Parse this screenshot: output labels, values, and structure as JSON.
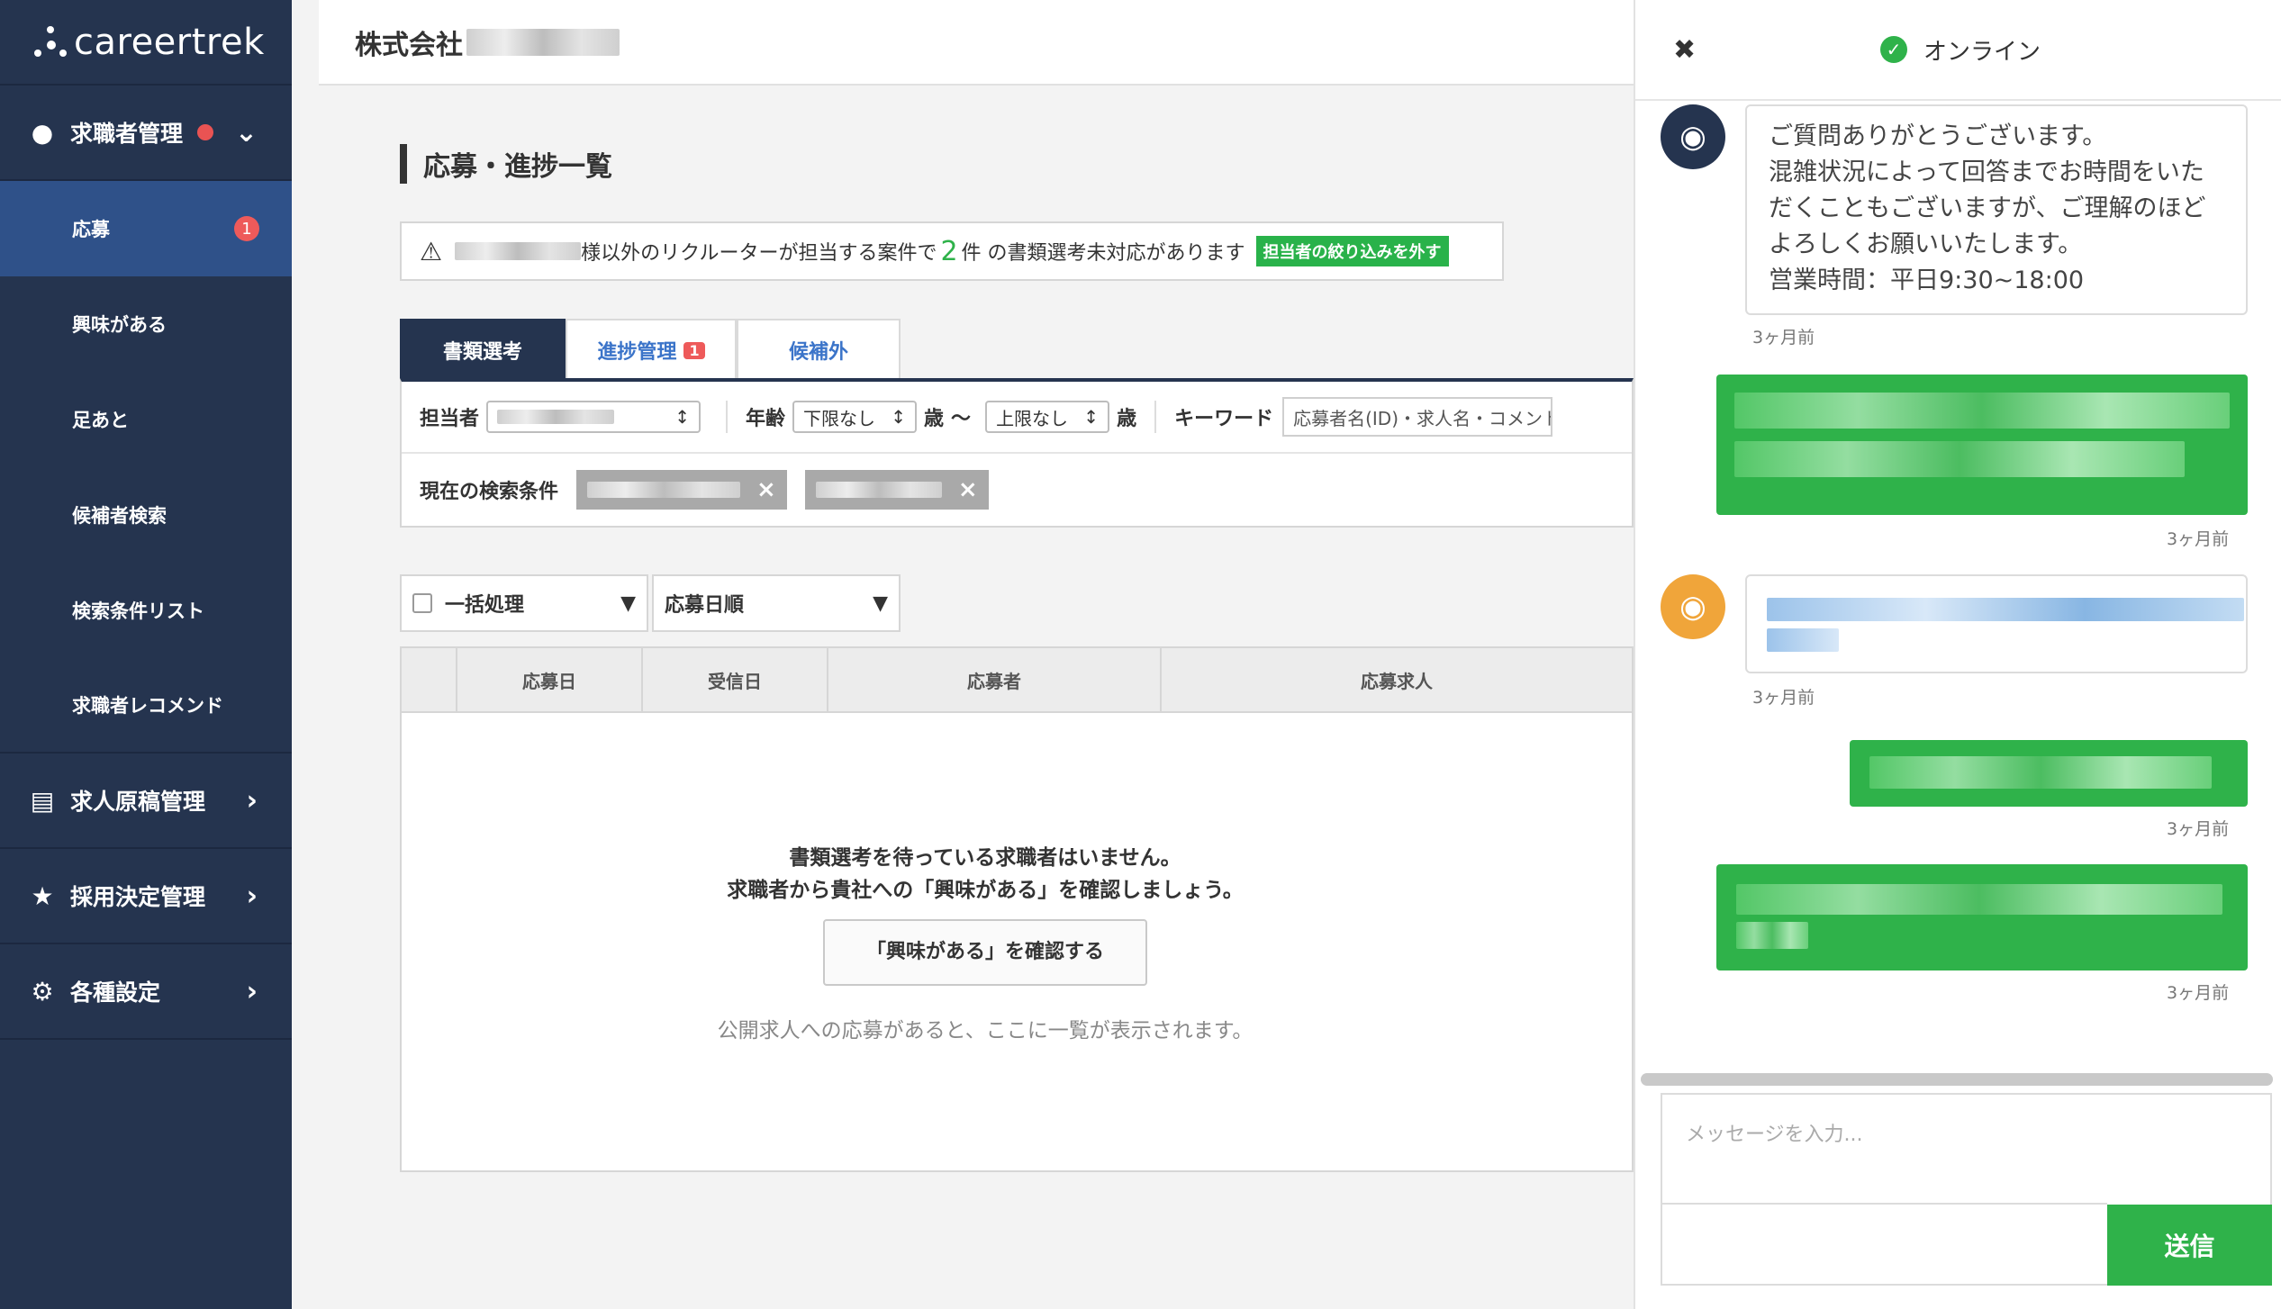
{
  "sidebar": {
    "logo_text": "careertrek",
    "candidate_management": {
      "label": "求職者管理",
      "items": [
        {
          "label": "応募",
          "badge": "1"
        },
        {
          "label": "興味がある"
        },
        {
          "label": "足あと"
        },
        {
          "label": "候補者検索"
        },
        {
          "label": "検索条件リスト"
        },
        {
          "label": "求職者レコメンド"
        }
      ]
    },
    "groups": [
      {
        "label": "求人原稿管理",
        "icon": "document-icon"
      },
      {
        "label": "採用決定管理",
        "icon": "star-icon"
      },
      {
        "label": "各種設定",
        "icon": "gear-icon"
      }
    ]
  },
  "header": {
    "company": "株式会社"
  },
  "page": {
    "title": "応募・進捗一覧",
    "notice": {
      "text_a": "様以外のリクルーターが担当する案件で",
      "count": "2",
      "text_b": "件 の書類選考未対応があります",
      "tag": "担当者の絞り込みを外す"
    },
    "tabs": [
      {
        "label": "書類選考"
      },
      {
        "label": "進捗管理",
        "badge": "1"
      },
      {
        "label": "候補外"
      }
    ],
    "filter": {
      "owner_label": "担当者",
      "age_label": "年齢",
      "age_min": "下限なし",
      "age_max": "上限なし",
      "age_unit": "歳",
      "age_sep": "〜",
      "keyword_label": "キーワード",
      "keyword_placeholder": "応募者名(ID)・求人名・コメント",
      "current_label": "現在の検索条件"
    },
    "bulk": {
      "bulk_label": "一括処理",
      "sort_label": "応募日順"
    },
    "table": {
      "columns": [
        "応募日",
        "受信日",
        "応募者",
        "応募求人"
      ],
      "empty_line1": "書類選考を待っている求職者はいません。",
      "empty_line2": "求職者から貴社への「興味がある」を確認しましょう。",
      "empty_button": "「興味がある」を確認する",
      "empty_hint": "公開求人への応募があると、ここに一覧が表示されます。"
    }
  },
  "chat": {
    "status": "オンライン",
    "messages": [
      {
        "from": "support",
        "lines": [
          "ご質問ありがとうございます。",
          "混雑状況によって回答までお時間をいた",
          "だくこともございますが、ご理解のほど",
          "よろしくお願いいたします。",
          "営業時間：平日9:30~18:00"
        ],
        "time": "3ヶ月前"
      },
      {
        "from": "user",
        "time": "3ヶ月前"
      },
      {
        "from": "support",
        "time": "3ヶ月前"
      },
      {
        "from": "user",
        "time": "3ヶ月前"
      },
      {
        "from": "user",
        "time": "3ヶ月前"
      }
    ],
    "input_placeholder": "メッセージを入力...",
    "send_label": "送信"
  },
  "colors": {
    "sidebar": "#25344f",
    "active": "#2f5189",
    "accent": "#2fb24a",
    "alert": "#ee5a5a"
  }
}
